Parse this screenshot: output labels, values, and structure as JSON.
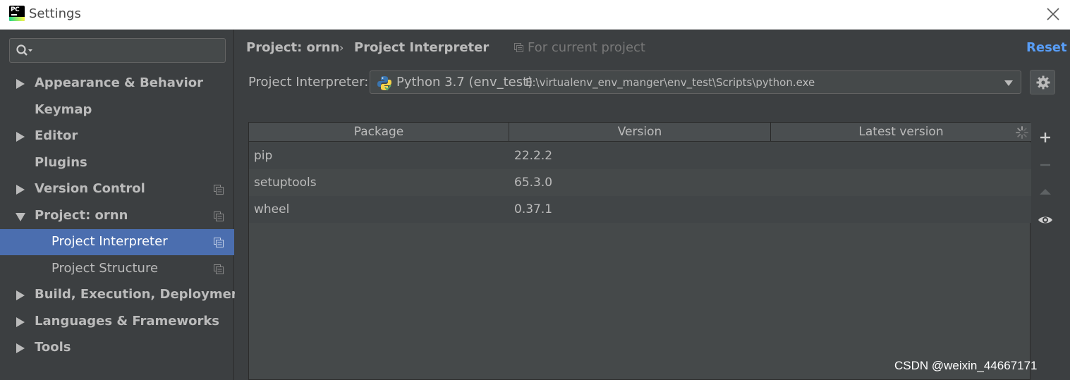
{
  "window": {
    "title": "Settings",
    "app_icon": "pycharm-logo",
    "app_icon_text": "PC"
  },
  "sidebar": {
    "search": {
      "value": "",
      "placeholder": ""
    },
    "items": [
      {
        "label": "Appearance & Behavior",
        "expandable": true,
        "expanded": false
      },
      {
        "label": "Keymap",
        "expandable": false
      },
      {
        "label": "Editor",
        "expandable": true,
        "expanded": false
      },
      {
        "label": "Plugins",
        "expandable": false
      },
      {
        "label": "Version Control",
        "expandable": true,
        "expanded": false,
        "project_scope": true
      },
      {
        "label": "Project: ornn",
        "expandable": true,
        "expanded": true,
        "project_scope": true
      },
      {
        "label": "Project Interpreter",
        "sub": true,
        "selected": true,
        "project_scope": true
      },
      {
        "label": "Project Structure",
        "sub": true,
        "project_scope": true
      },
      {
        "label": "Build, Execution, Deployment",
        "expandable": true,
        "expanded": false
      },
      {
        "label": "Languages & Frameworks",
        "expandable": true,
        "expanded": false
      },
      {
        "label": "Tools",
        "expandable": true,
        "expanded": false
      }
    ]
  },
  "header": {
    "breadcrumb_project": "Project: ornn",
    "breadcrumb_separator": "›",
    "breadcrumb_current": "Project Interpreter",
    "scope_note": "For current project",
    "reset_label": "Reset"
  },
  "interpreter": {
    "label": "Project Interpreter:",
    "name": "Python 3.7 (env_test)",
    "path": "E:\\virtualenv_env_manger\\env_test\\Scripts\\python.exe"
  },
  "packages_table": {
    "columns": [
      "Package",
      "Version",
      "Latest version"
    ],
    "rows": [
      {
        "package": "pip",
        "version": "22.2.2",
        "latest": ""
      },
      {
        "package": "setuptools",
        "version": "65.3.0",
        "latest": ""
      },
      {
        "package": "wheel",
        "version": "0.37.1",
        "latest": ""
      }
    ]
  },
  "tools": [
    "plus-icon",
    "minus-icon",
    "upgrade-icon",
    "eye-icon"
  ],
  "watermark": "CSDN @weixin_44667171",
  "colors": {
    "background": "#3c3f41",
    "selection": "#4b6eaf",
    "link": "#589df6",
    "text": "#bbbbbb"
  }
}
